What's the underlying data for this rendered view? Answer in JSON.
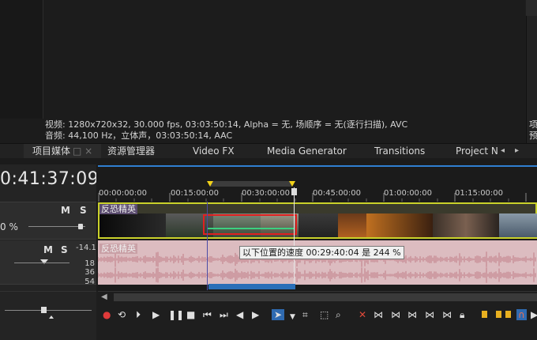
{
  "media_info": {
    "video_line": "视频: 1280x720x32, 30.000 fps, 03:03:50:14, Alpha = 无, 场顺序 = 无(逐行扫描), AVC",
    "audio_line": "音频: 44,100 Hz，立体声，03:03:50:14, AAC"
  },
  "right_panel": {
    "line1": "项",
    "line2": "预"
  },
  "tabs": [
    {
      "label": "项目媒体"
    },
    {
      "label": "资源管理器"
    },
    {
      "label": "Video FX"
    },
    {
      "label": "Media Generator"
    },
    {
      "label": "Transitions"
    },
    {
      "label": "Project N"
    }
  ],
  "tab_close": "□ ×",
  "timecode": "0:41:37:09",
  "video_track": {
    "m": "M",
    "s": "S",
    "level": "0 %",
    "clip_label": "反恐精英"
  },
  "audio_track": {
    "m": "M",
    "s": "S",
    "db_top": "-14.1",
    "db_scale": [
      "18",
      "36",
      "54"
    ],
    "clip_label": "反恐精英"
  },
  "ruler_ticks": [
    "00:00:00:00",
    "00:15:00:00",
    "00:30:00:00",
    "00:45:00:00",
    "01:00:00:00",
    "01:15:00:00"
  ],
  "tooltip": "以下位置的速度 00:29:40:04 是 244 %",
  "colors": {
    "accent_blue": "#2f7fd0",
    "clip_border": "#c9d12a",
    "audio_clip": "#dcbcc0",
    "highlight_red": "#e02020",
    "speed_line": "#3bd080",
    "loop_marker": "#f2d21a"
  },
  "transport_icons": [
    "record-icon",
    "loop-icon",
    "play-from-start-icon",
    "play-icon",
    "pause-icon",
    "stop-icon",
    "go-to-start-icon",
    "go-to-end-icon",
    "prev-frame-icon",
    "next-frame-icon",
    "normal-edit-tool-icon",
    "envelope-tool-icon",
    "selection-tool-icon",
    "zoom-tool-icon",
    "delete-icon",
    "trim-start-icon",
    "trim-end-icon",
    "split-icon",
    "lock-icon",
    "marker-icon",
    "region-icon",
    "snapping-icon"
  ]
}
